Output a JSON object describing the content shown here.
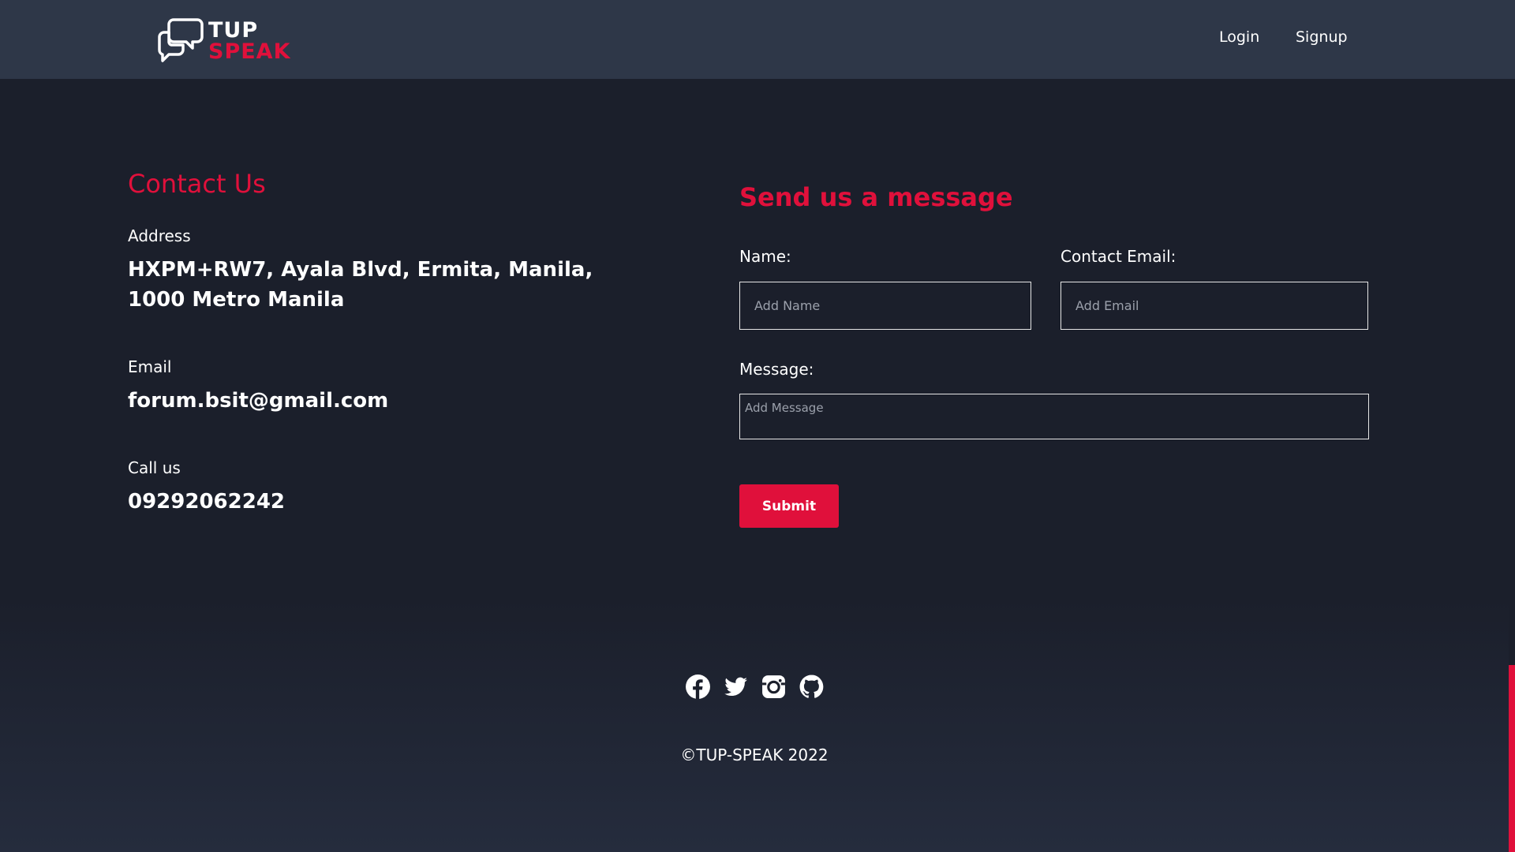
{
  "header": {
    "logo": {
      "line1": "TUP",
      "line2": "SPEAK"
    },
    "nav": {
      "login": "Login",
      "signup": "Signup"
    }
  },
  "contact": {
    "title": "Contact Us",
    "address_label": "Address",
    "address_value": "HXPM+RW7, Ayala Blvd, Ermita, Manila, 1000 Metro Manila",
    "email_label": "Email",
    "email_value": "forum.bsit@gmail.com",
    "call_label": "Call us",
    "call_value": "09292062242"
  },
  "form": {
    "title": "Send us a message",
    "name_label": "Name:",
    "name_placeholder": "Add Name",
    "email_label": "Contact Email:",
    "email_placeholder": "Add Email",
    "message_label": "Message:",
    "message_placeholder": "Add Message",
    "submit_label": "Submit"
  },
  "footer": {
    "social_icons": [
      "facebook-icon",
      "twitter-icon",
      "instagram-icon",
      "github-icon"
    ],
    "copyright": "©TUP-SPEAK 2022"
  },
  "colors": {
    "accent": "#e0103b",
    "header_bg": "#2e3748",
    "page_bg": "#1b1f2b"
  }
}
